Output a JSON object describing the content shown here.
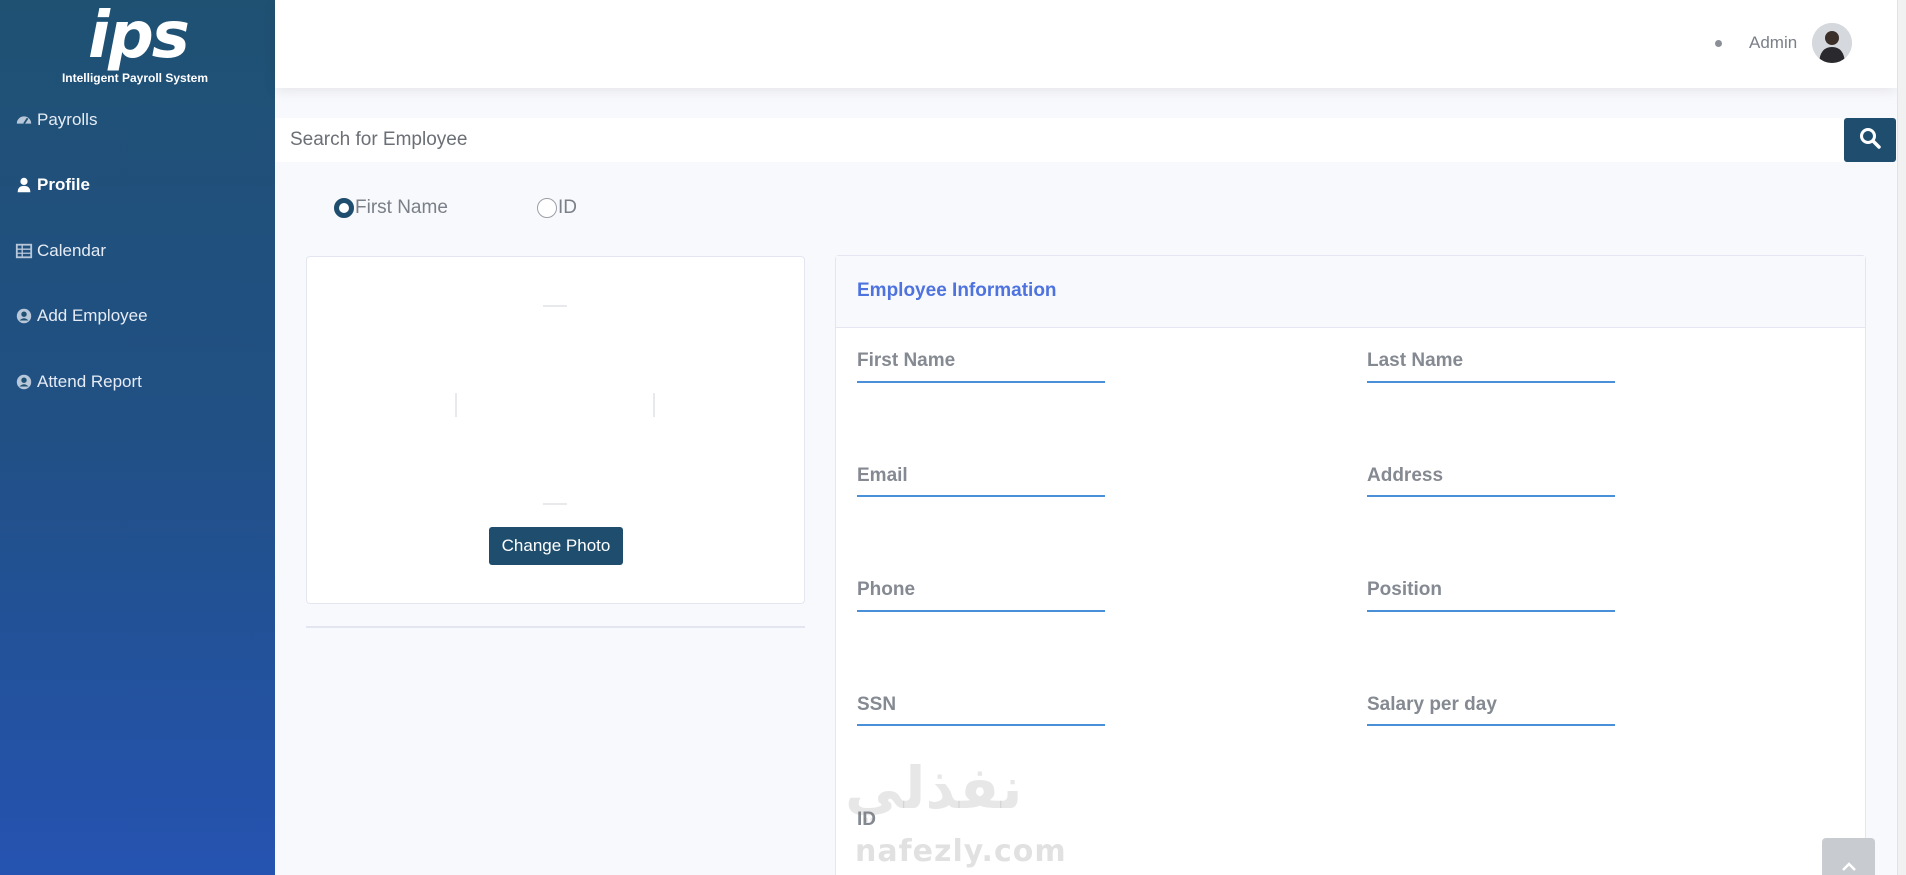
{
  "brand": {
    "logo_text": "ips",
    "subtitle": "Intelligent Payroll System"
  },
  "sidebar": {
    "items": [
      {
        "label": "Payrolls",
        "icon": "gauge-icon",
        "active": false
      },
      {
        "label": "Profile",
        "icon": "user-icon",
        "active": true
      },
      {
        "label": "Calendar",
        "icon": "table-icon",
        "active": false
      },
      {
        "label": "Add Employee",
        "icon": "user-circle-icon",
        "active": false
      },
      {
        "label": "Attend Report",
        "icon": "user-circle-icon",
        "active": false
      }
    ]
  },
  "topbar": {
    "user_name": "Admin",
    "avatar_icon": "avatar-icon"
  },
  "search": {
    "placeholder": "Search for Employee",
    "value": "",
    "button_icon": "search-icon"
  },
  "search_by": {
    "options": [
      {
        "label": "First Name",
        "checked": true
      },
      {
        "label": "ID",
        "checked": false
      }
    ]
  },
  "photo_card": {
    "change_photo_label": "Change Photo"
  },
  "employee_info": {
    "title": "Employee Information",
    "fields": {
      "first_name": {
        "label": "First Name",
        "value": ""
      },
      "last_name": {
        "label": "Last Name",
        "value": ""
      },
      "email": {
        "label": "Email",
        "value": ""
      },
      "address": {
        "label": "Address",
        "value": ""
      },
      "phone": {
        "label": "Phone",
        "value": ""
      },
      "position": {
        "label": "Position",
        "value": ""
      },
      "ssn": {
        "label": "SSN",
        "value": ""
      },
      "salary": {
        "label": "Salary per day",
        "value": ""
      },
      "id": {
        "label": "ID",
        "value": ""
      }
    }
  },
  "watermark": {
    "arabic": "نفذلي",
    "latin": "nafezly.com"
  },
  "colors": {
    "sidebar_top": "#1f5173",
    "sidebar_bottom": "#2553b1",
    "primary": "#1f4d6e",
    "accent": "#4e73df",
    "input_underline": "#4a90d9"
  }
}
